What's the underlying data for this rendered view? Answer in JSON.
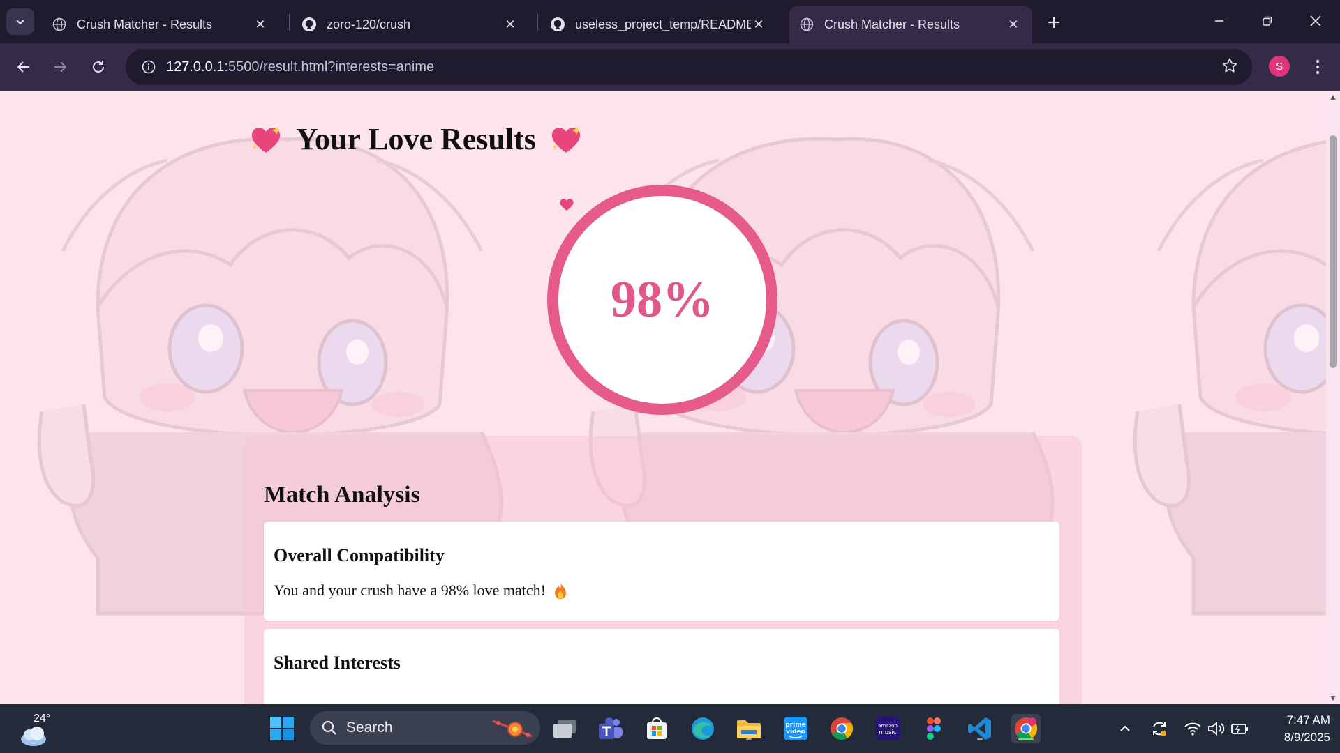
{
  "browser": {
    "tabs": [
      {
        "title": "Crush Matcher - Results",
        "favicon": "globe-icon",
        "active": false
      },
      {
        "title": "zoro-120/crush",
        "favicon": "github-icon",
        "active": false
      },
      {
        "title": "useless_project_temp/README.",
        "favicon": "github-icon",
        "active": false
      },
      {
        "title": "Crush Matcher - Results",
        "favicon": "globe-icon",
        "active": true
      }
    ],
    "url_host": "127.0.0.1",
    "url_rest": ":5500/result.html?interests=anime",
    "profile_initial": "S"
  },
  "page": {
    "title": "Your Love Results",
    "score": "98%",
    "analysis": {
      "heading": "Match Analysis",
      "cards": [
        {
          "title": "Overall Compatibility",
          "text": "You and your crush have a 98% love match!"
        },
        {
          "title": "Shared Interests",
          "text": ""
        }
      ]
    }
  },
  "taskbar": {
    "temperature": "24°",
    "search_placeholder": "Search",
    "time": "7:47 AM",
    "date": "8/9/2025"
  },
  "colors": {
    "accent_pink": "#e65a8c",
    "page_bg": "#fde3ef",
    "chrome_dark": "#1f1a2e",
    "chrome_toolbar": "#342b48"
  }
}
